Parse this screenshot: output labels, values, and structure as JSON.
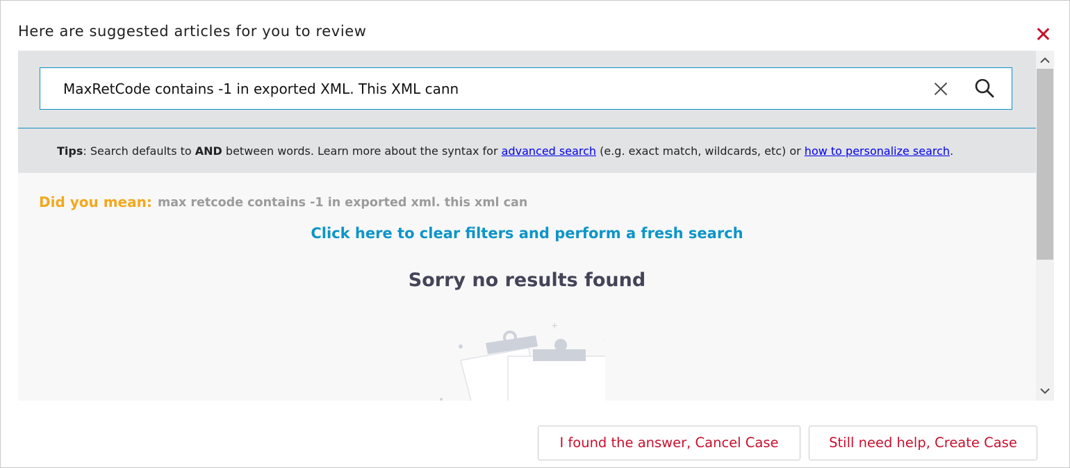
{
  "dialog": {
    "title": "Here are suggested articles for you to review",
    "close_icon": "close-icon",
    "accent_color": "#c8102e"
  },
  "search": {
    "query": "MaxRetCode contains -1 in exported XML. This XML cann",
    "clear_icon": "clear-icon",
    "search_icon": "search-icon",
    "border_color": "#0b8fc6"
  },
  "tips": {
    "label": "Tips",
    "text_1": ": Search defaults to ",
    "keyword": "AND",
    "text_2": " between words. Learn more about the syntax for ",
    "link_advanced": "advanced search",
    "text_3": " (e.g. exact match, wildcards, etc) or ",
    "link_personalize": "how to personalize search",
    "text_4": "."
  },
  "results": {
    "did_you_mean_label": "Did you mean:",
    "did_you_mean_color": "#f2a81d",
    "suggestion": "max retcode contains -1 in exported xml. this xml can",
    "clear_filters_link": "Click here to clear filters and perform a fresh search",
    "link_color": "#0c95c7",
    "no_results": "Sorry no results found",
    "illustration_icon": "empty-clipboard-illustration"
  },
  "actions": {
    "cancel_case": "I found the answer, Cancel Case",
    "create_case": "Still need help, Create Case"
  }
}
